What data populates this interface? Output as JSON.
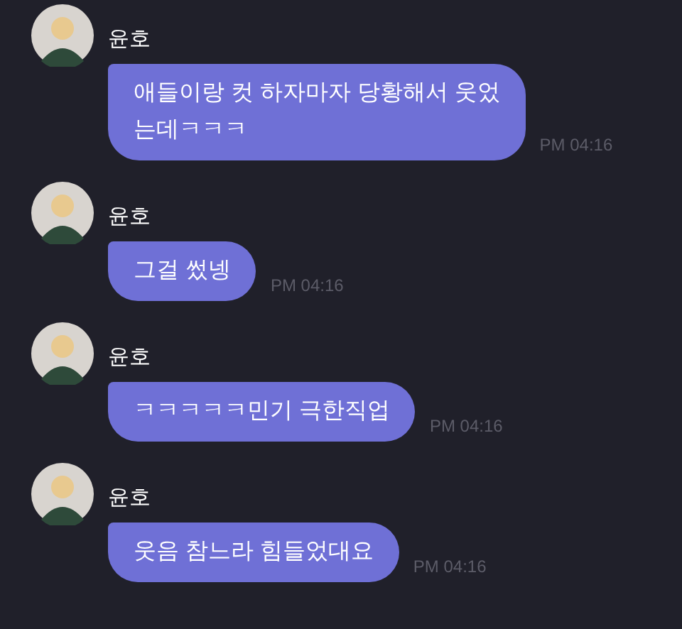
{
  "messages": [
    {
      "sender": "윤호",
      "text": "애들이랑 컷 하자마자 당황해서 웃었\n는데ㅋㅋㅋ",
      "time": "PM 04:16"
    },
    {
      "sender": "윤호",
      "text": "그걸 썼넹",
      "time": "PM 04:16"
    },
    {
      "sender": "윤호",
      "text": "ㅋㅋㅋㅋㅋ민기 극한직업",
      "time": "PM 04:16"
    },
    {
      "sender": "윤호",
      "text": "웃음 참느라 힘들었대요",
      "time": "PM 04:16"
    }
  ]
}
